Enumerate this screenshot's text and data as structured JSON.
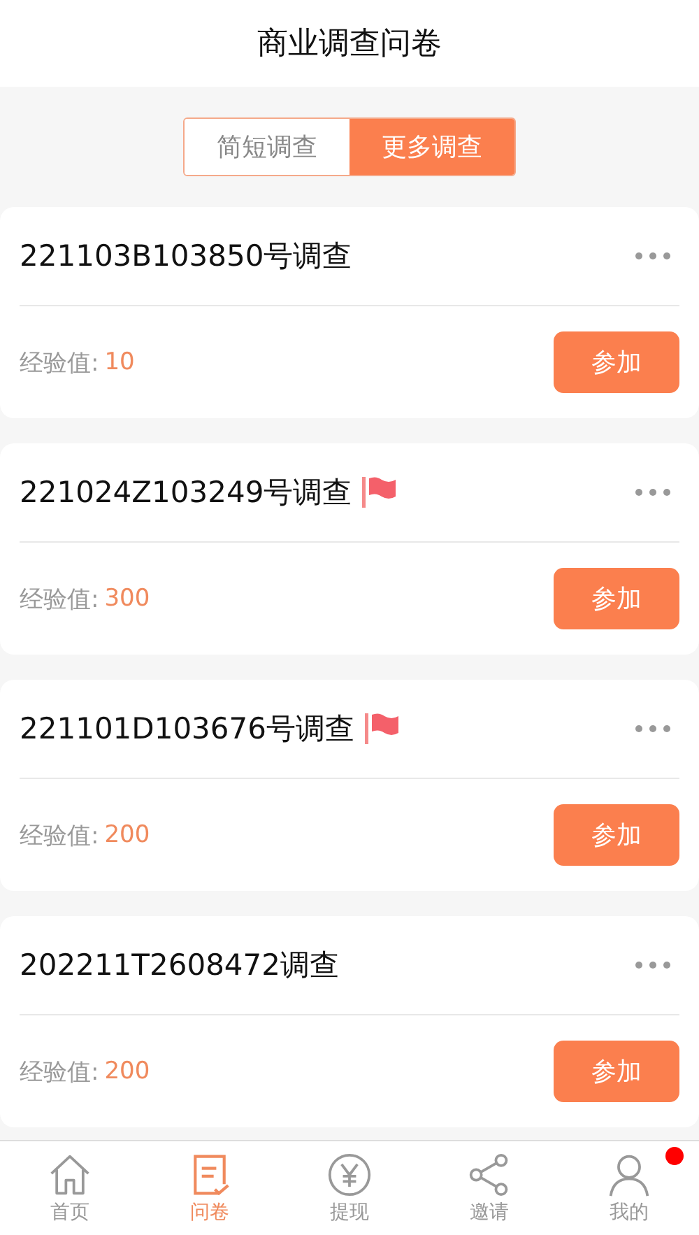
{
  "header": {
    "title": "商业调查问卷"
  },
  "segments": [
    {
      "label": "简短调查",
      "selected": false
    },
    {
      "label": "更多调查",
      "selected": true
    }
  ],
  "surveys": [
    {
      "title": "221103B103850号调查",
      "flagged": false,
      "label": "经验值:",
      "value": "10",
      "button": "参加"
    },
    {
      "title": "221024Z103249号调查",
      "flagged": true,
      "label": "经验值:",
      "value": "300",
      "button": "参加"
    },
    {
      "title": "221101D103676号调查",
      "flagged": true,
      "label": "经验值:",
      "value": "200",
      "button": "参加"
    },
    {
      "title": "202211T2608472调查",
      "flagged": false,
      "label": "经验值:",
      "value": "200",
      "button": "参加"
    }
  ],
  "tabbar": [
    {
      "kind": "home",
      "label": "首页",
      "selected": false,
      "badge": false
    },
    {
      "kind": "survey",
      "label": "问卷",
      "selected": true,
      "badge": false
    },
    {
      "kind": "yen",
      "label": "提现",
      "selected": false,
      "badge": false
    },
    {
      "kind": "share",
      "label": "邀请",
      "selected": false,
      "badge": false
    },
    {
      "kind": "user",
      "label": "我的",
      "selected": false,
      "badge": true
    }
  ]
}
